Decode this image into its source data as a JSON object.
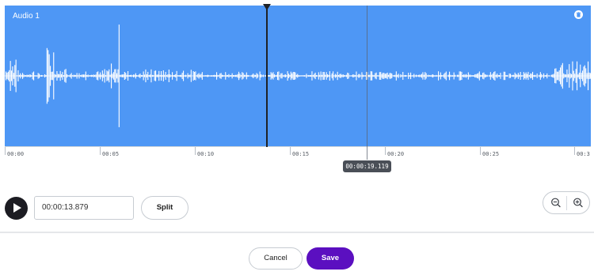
{
  "track": {
    "title": "Audio 1",
    "color": "#4e97f5",
    "delete_icon": "trash-icon"
  },
  "timeline": {
    "labels": [
      "00:00",
      "00:05",
      "00:10",
      "00:15",
      "00:20",
      "00:25",
      "00:3"
    ],
    "playhead_time": "00:00:13.879",
    "hover_time": "00:00:19.119"
  },
  "controls": {
    "play_icon": "play-icon",
    "time_value": "00:00:13.879",
    "split_label": "Split",
    "zoom_out_icon": "zoom-out-icon",
    "zoom_in_icon": "zoom-in-icon"
  },
  "footer": {
    "cancel_label": "Cancel",
    "save_label": "Save",
    "save_color": "#5b0fc0"
  }
}
